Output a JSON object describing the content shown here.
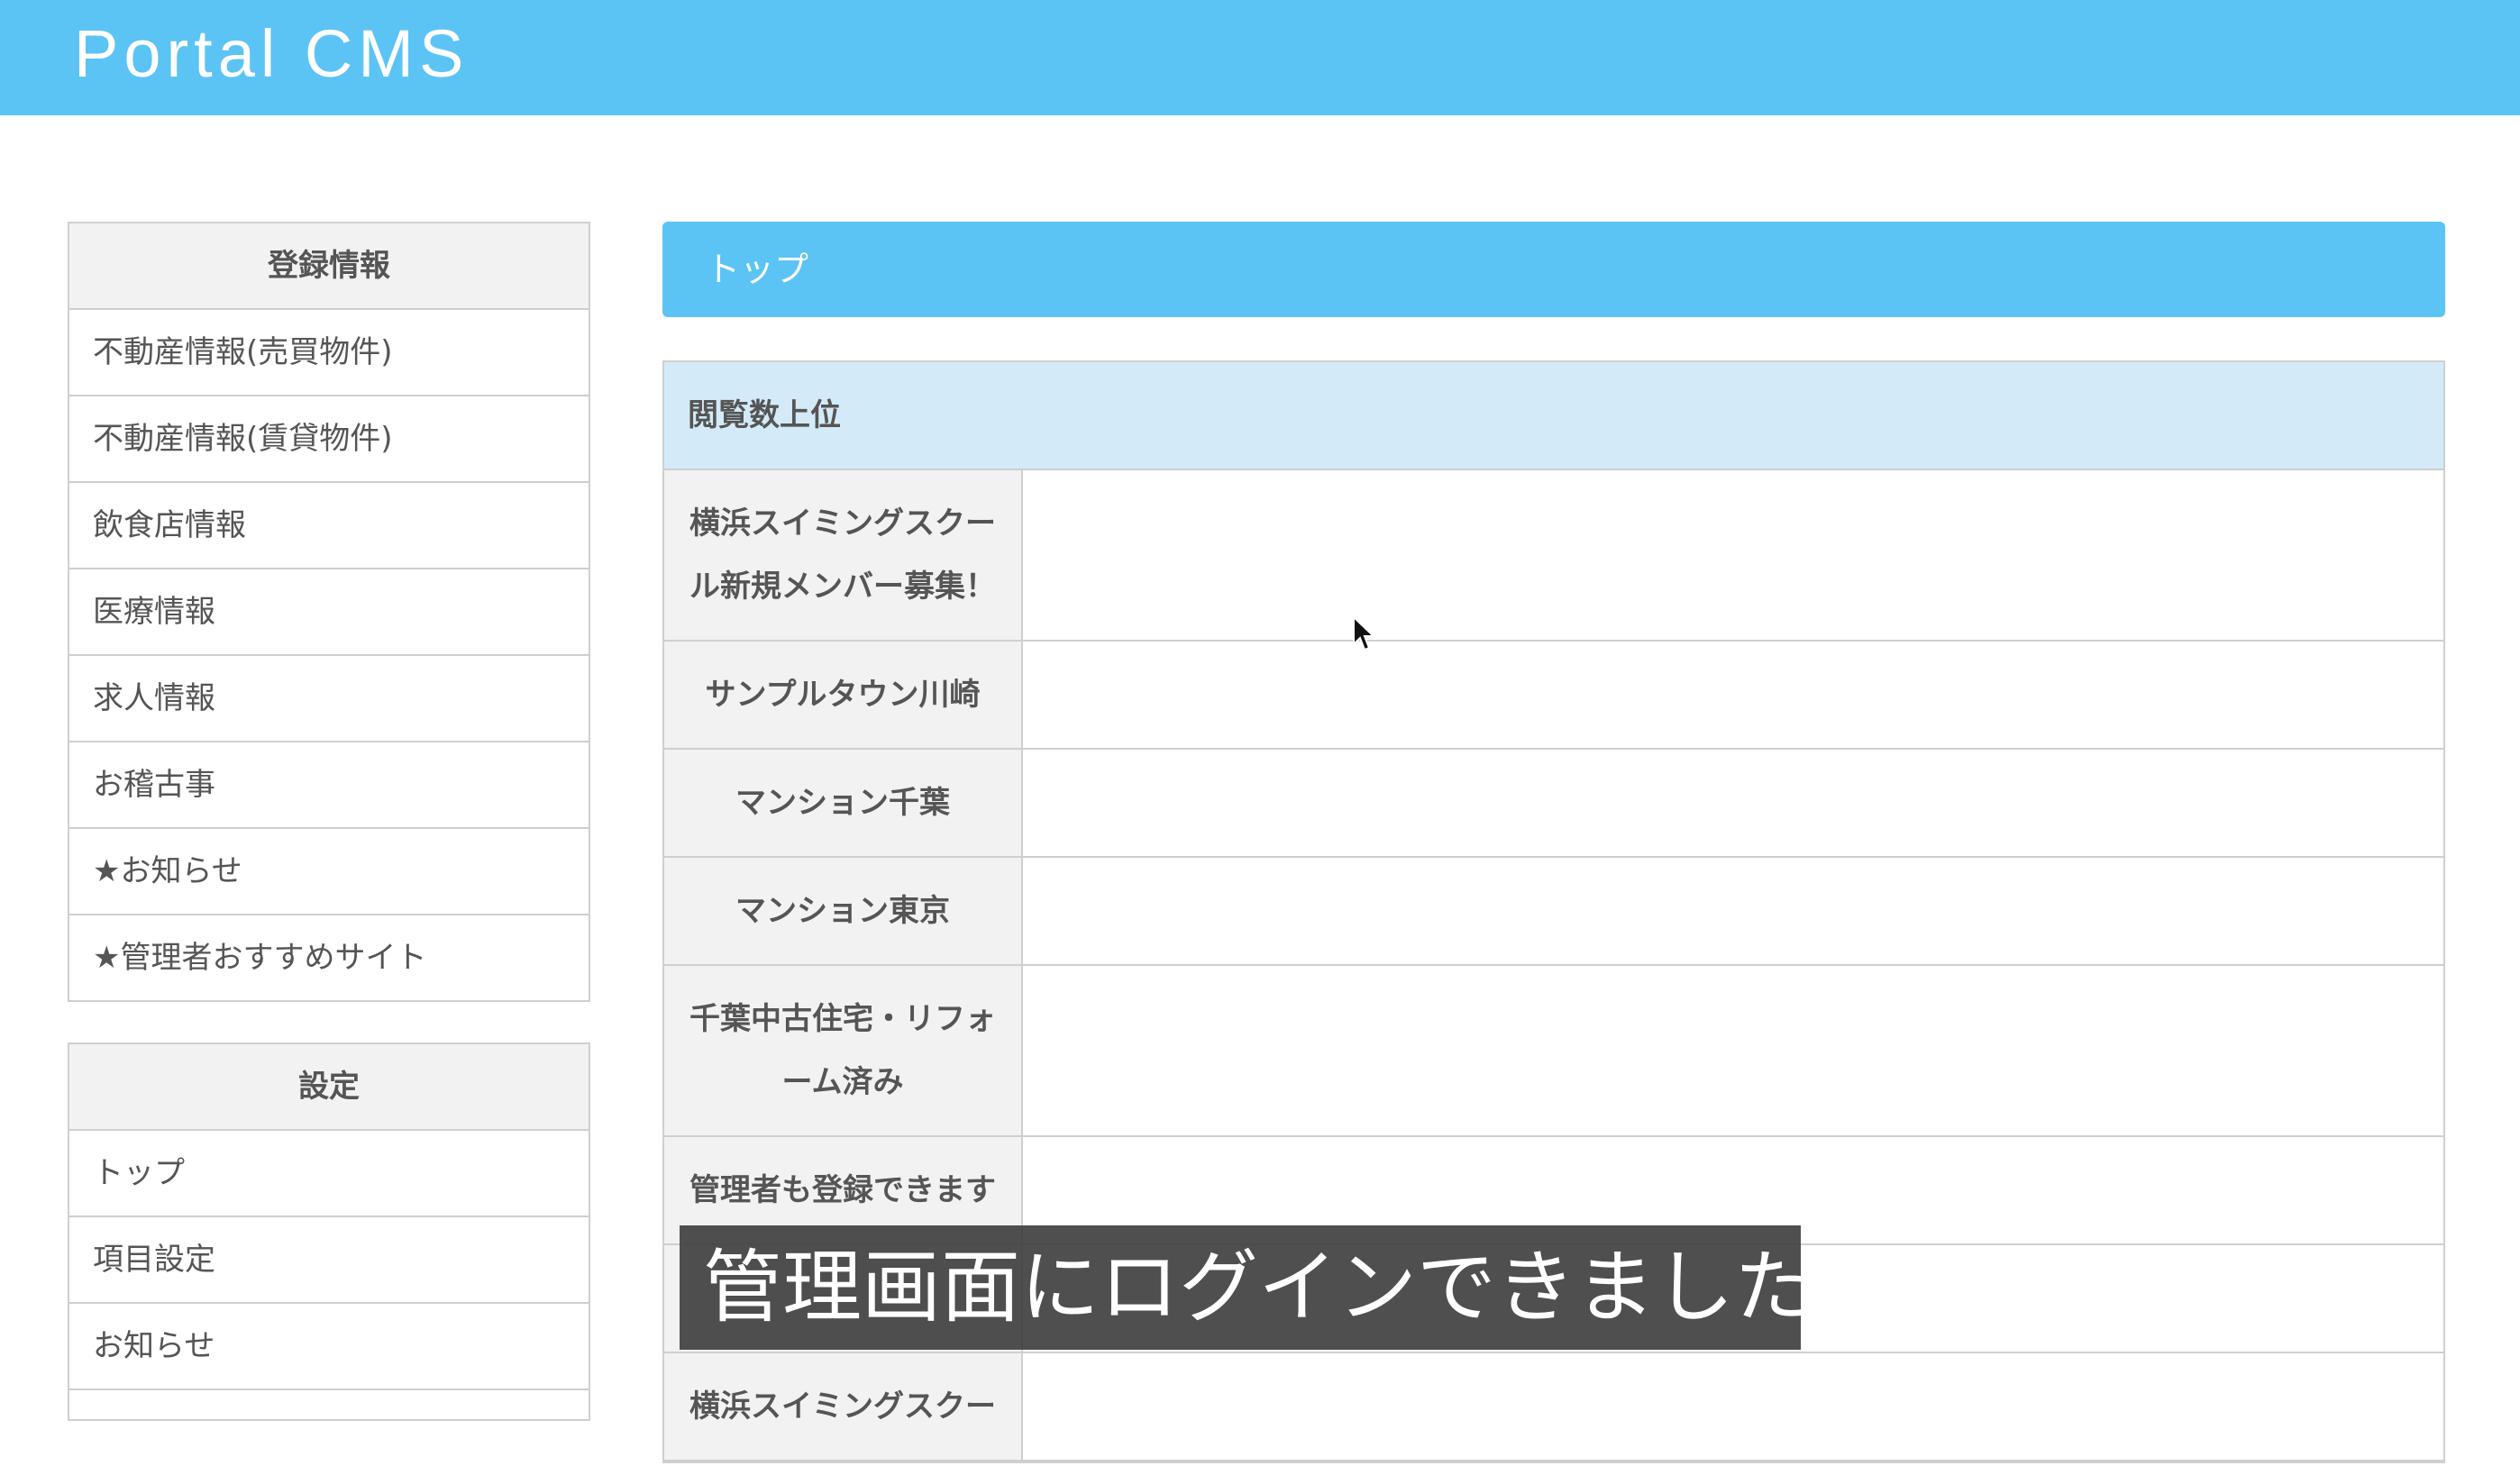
{
  "header": {
    "title": "Portal CMS"
  },
  "sidebar": {
    "registration": {
      "title": "登録情報",
      "items": [
        "不動産情報(売買物件)",
        "不動産情報(賃貸物件)",
        "飲食店情報",
        "医療情報",
        "求人情報",
        "お稽古事",
        "★お知らせ",
        "★管理者おすすめサイト"
      ]
    },
    "settings": {
      "title": "設定",
      "items": [
        "トップ",
        "項目設定",
        "お知らせ",
        ""
      ]
    }
  },
  "main": {
    "title": "トップ",
    "ranking": {
      "title": "閲覧数上位",
      "rows": [
        "横浜スイミングスクール新規メンバー募集！",
        "サンプルタウン川崎",
        "マンション千葉",
        "マンション東京",
        "千葉中古住宅・リフォーム済み",
        "管理者も登録できます",
        "",
        "横浜スイミングスクー"
      ]
    }
  },
  "caption": "管理画面にログインできました。",
  "colors": {
    "accent": "#5bc4f4",
    "section_header": "#d3ebf8",
    "label_bg": "#f2f2f2"
  }
}
